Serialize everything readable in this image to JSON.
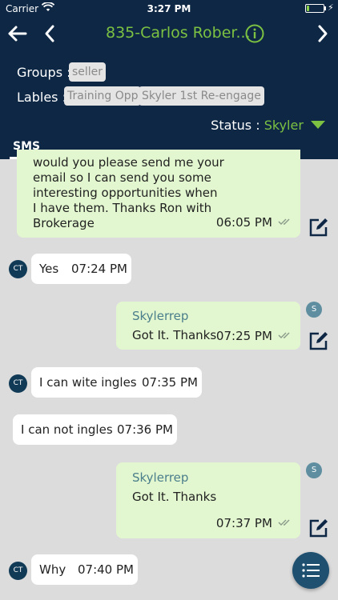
{
  "status_bar": {
    "carrier": "Carrier",
    "time": "3:27 PM",
    "battery_level": 0.15
  },
  "header": {
    "title": "835-Carlos Rober...",
    "groups_label": "Groups :",
    "groups": [
      "seller"
    ],
    "labels_label": "Lables :",
    "labels": [
      "Training Opp",
      "Skyler 1st Re-engage"
    ],
    "status_label": "Status :",
    "status_value": "Skyler",
    "tab": "SMS"
  },
  "icons": {
    "back": "arrow-left-icon",
    "prev": "chevron-left-icon",
    "next": "chevron-right-icon",
    "info": "info-icon",
    "edit": "edit-icon",
    "menu": "list-icon"
  },
  "colors": {
    "header_bg": "#0d2745",
    "accent": "#7cc142",
    "outgoing_bubble": "#e2f7cf",
    "incoming_bubble": "#ffffff",
    "background": "#dcdcdc"
  },
  "messages": [
    {
      "direction": "out",
      "text_lines": [
        "would you please send me your",
        "email so I can send you some",
        "interesting opportunities when",
        "I have them. Thanks Ron with",
        "Brokerage"
      ],
      "time": "06:05 PM"
    },
    {
      "direction": "in",
      "avatar": "CT",
      "text": "Yes",
      "time": "07:24 PM"
    },
    {
      "direction": "out",
      "avatar": "S",
      "sender": "Skylerrep",
      "text": "Got It. Thanks",
      "time": "07:25 PM"
    },
    {
      "direction": "in",
      "avatar": "CT",
      "text": "I can wite ingles",
      "time": "07:35 PM"
    },
    {
      "direction": "in",
      "text": "I can not ingles",
      "time": "07:36 PM"
    },
    {
      "direction": "out",
      "avatar": "S",
      "sender": "Skylerrep",
      "text": "Got It. Thanks",
      "time": "07:37 PM"
    },
    {
      "direction": "in",
      "avatar": "CT",
      "text": "Why",
      "time": "07:40 PM"
    }
  ]
}
